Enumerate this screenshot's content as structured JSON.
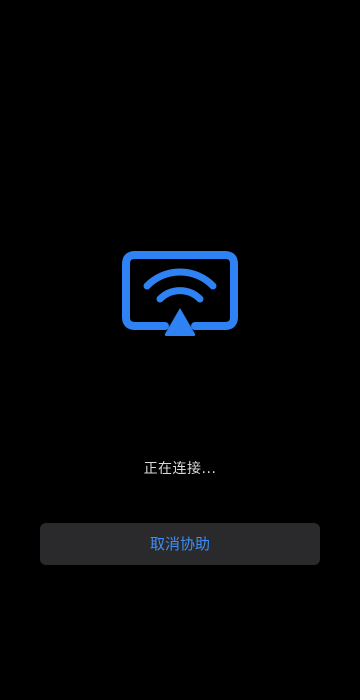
{
  "connection": {
    "status_text": "正在连接...",
    "cancel_label": "取消协助"
  },
  "icon": {
    "name": "screen-cast-icon",
    "color": "#2f82f4"
  },
  "colors": {
    "background": "#000000",
    "accent": "#2f82f4",
    "button_bg": "#2a2a2c",
    "button_text": "#3f8ef5",
    "status_text": "#d9d9d9"
  }
}
